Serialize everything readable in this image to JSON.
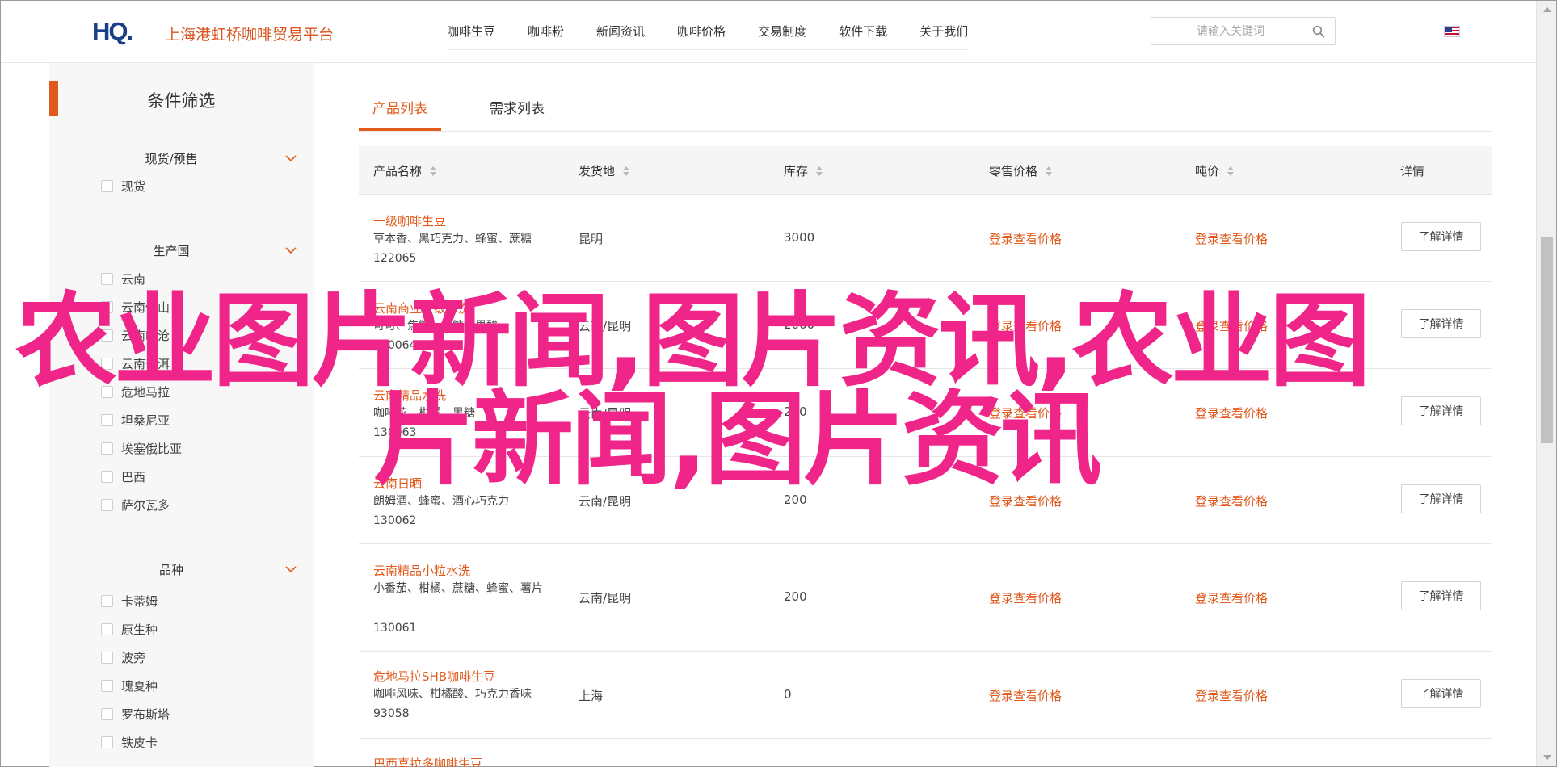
{
  "header": {
    "logo_text": "HQ.",
    "site_name": "上海港虹桥咖啡贸易平台",
    "nav": [
      "咖啡生豆",
      "咖啡粉",
      "新闻资讯",
      "咖啡价格",
      "交易制度",
      "软件下载",
      "关于我们"
    ],
    "search_placeholder": "请输入关键词",
    "search_icon": "search-icon",
    "language_icon": "us-flag-icon"
  },
  "sidebar": {
    "title": "条件筛选",
    "groups": [
      {
        "title": "现货/预售",
        "options": [
          "现货"
        ]
      },
      {
        "title": "生产国",
        "options": [
          "云南",
          "云南保山",
          "云南临沧",
          "云南普洱",
          "危地马拉",
          "坦桑尼亚",
          "埃塞俄比亚",
          "巴西",
          "萨尔瓦多"
        ]
      },
      {
        "title": "品种",
        "options": [
          "卡蒂姆",
          "原生种",
          "波旁",
          "瑰夏种",
          "罗布斯塔",
          "铁皮卡"
        ]
      }
    ]
  },
  "tabs": [
    "产品列表",
    "需求列表"
  ],
  "table": {
    "headers": [
      "产品名称",
      "发货地",
      "库存",
      "零售价格",
      "吨价",
      "详情"
    ],
    "rows": [
      {
        "name": "一级咖啡生豆",
        "desc": "草本香、黑巧克力、蜂蜜、蔗糖",
        "code": "122065",
        "origin": "昆明",
        "stock": "3000",
        "retail": "登录查看价格",
        "ton": "登录查看价格",
        "detail": "了解详情"
      },
      {
        "name": "云南商业一级水洗",
        "desc": "可可、焦糖、蔗糖、果酸",
        "code": "130064",
        "origin": "云南/昆明",
        "stock": "2000",
        "retail": "登录查看价格",
        "ton": "登录查看价格",
        "detail": "了解详情"
      },
      {
        "name": "云南精品水洗",
        "desc": "咖啡花、柑橘、黑糖",
        "code": "130063",
        "origin": "云南/昆明",
        "stock": "200",
        "retail": "登录查看价格",
        "ton": "登录查看价格",
        "detail": "了解详情"
      },
      {
        "name": "云南日晒",
        "desc": "朗姆酒、蜂蜜、酒心巧克力",
        "code": "130062",
        "origin": "云南/昆明",
        "stock": "200",
        "retail": "登录查看价格",
        "ton": "登录查看价格",
        "detail": "了解详情"
      },
      {
        "name": "云南精品小粒水洗",
        "desc": "小番茄、柑橘、蔗糖、蜂蜜、薯片",
        "code": "130061",
        "origin": "云南/昆明",
        "stock": "200",
        "retail": "登录查看价格",
        "ton": "登录查看价格",
        "detail": "了解详情"
      },
      {
        "name": "危地马拉SHB咖啡生豆",
        "desc": "咖啡风味、柑橘酸、巧克力香味",
        "code": "93058",
        "origin": "上海",
        "stock": "0",
        "retail": "登录查看价格",
        "ton": "登录查看价格",
        "detail": "了解详情"
      },
      {
        "name": "巴西喜拉多咖啡生豆",
        "desc": "",
        "code": "",
        "origin": "",
        "stock": "",
        "retail": "",
        "ton": "",
        "detail": ""
      }
    ]
  },
  "watermark": {
    "line1": "农业图片新闻,图片资讯,农业图",
    "line2": "片新闻,图片资讯"
  },
  "colors": {
    "accent": "#e05a1c",
    "watermark": "#f0258a",
    "sidebar_bg": "#f7f7f7"
  }
}
